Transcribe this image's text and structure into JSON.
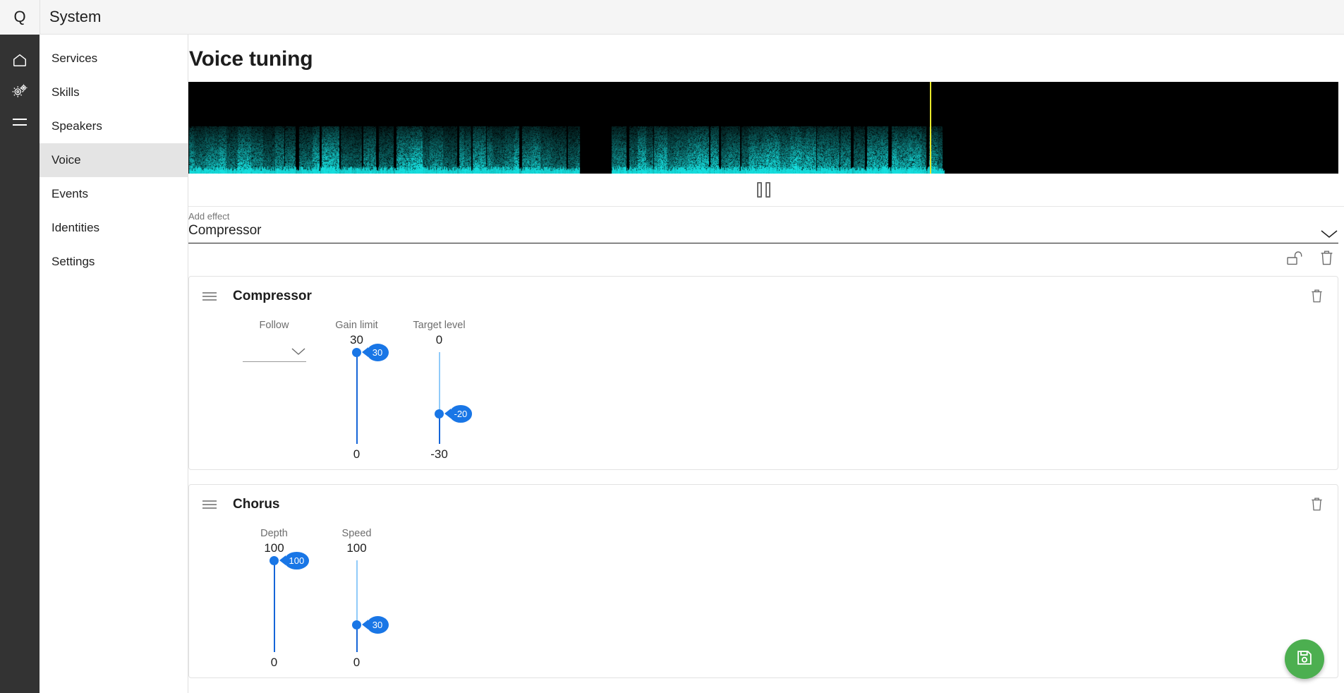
{
  "window": {
    "logo": "Q",
    "title": "System"
  },
  "rail": {
    "items": [
      {
        "icon": "home-icon",
        "name": "rail-item-home"
      },
      {
        "icon": "gears-icon",
        "name": "rail-item-services"
      },
      {
        "icon": "hamburger-icon",
        "name": "rail-item-menu"
      }
    ]
  },
  "sidebar": {
    "items": [
      {
        "label": "Services",
        "active": false
      },
      {
        "label": "Skills",
        "active": false
      },
      {
        "label": "Speakers",
        "active": false
      },
      {
        "label": "Voice",
        "active": true
      },
      {
        "label": "Events",
        "active": false
      },
      {
        "label": "Identities",
        "active": false
      },
      {
        "label": "Settings",
        "active": false
      }
    ]
  },
  "page": {
    "title": "Voice tuning"
  },
  "spectrogram": {
    "name": "voice-spectrogram",
    "background_color": "#000000",
    "trace_color": "#16e0e0",
    "playhead_color": "#e8e82a",
    "playhead_position_pct": 64.5
  },
  "transport": {
    "pause_label": "Pause",
    "icon": "pause-icon"
  },
  "add_effect": {
    "label": "Add effect",
    "value": "Compressor",
    "chevron_icon": "chevron-down-icon",
    "options": [
      "Compressor",
      "Chorus"
    ]
  },
  "toolbar": {
    "lock_icon": "unlock-icon",
    "lock_label": "Unlock",
    "delete_icon": "trash-icon",
    "delete_label": "Delete all"
  },
  "fab": {
    "icon": "save-icon",
    "label": "Save"
  },
  "colors": {
    "accent_blue": "#1976e6",
    "track_inactive": "#90caf9",
    "track_active": "#1565d8",
    "fab_green": "#4caf50",
    "rail_dark": "#333333",
    "nav_active": "#e4e4e4"
  },
  "effects": [
    {
      "name": "Compressor",
      "drag_icon": "drag-handle-icon",
      "delete_icon": "trash-icon",
      "params": [
        {
          "kind": "select",
          "name": "Follow",
          "value": "",
          "chevron_icon": "chevron-down-icon"
        },
        {
          "kind": "slider",
          "name": "Gain limit",
          "max": "30",
          "min": "0",
          "value": "30",
          "value_pct": 100
        },
        {
          "kind": "slider",
          "name": "Target level",
          "max": "0",
          "min": "-30",
          "value": "-20",
          "value_pct": 33
        }
      ]
    },
    {
      "name": "Chorus",
      "drag_icon": "drag-handle-icon",
      "delete_icon": "trash-icon",
      "params": [
        {
          "kind": "slider",
          "name": "Depth",
          "max": "100",
          "min": "0",
          "value": "100",
          "value_pct": 100
        },
        {
          "kind": "slider",
          "name": "Speed",
          "max": "100",
          "min": "0",
          "value": "30",
          "value_pct": 30
        }
      ]
    }
  ]
}
